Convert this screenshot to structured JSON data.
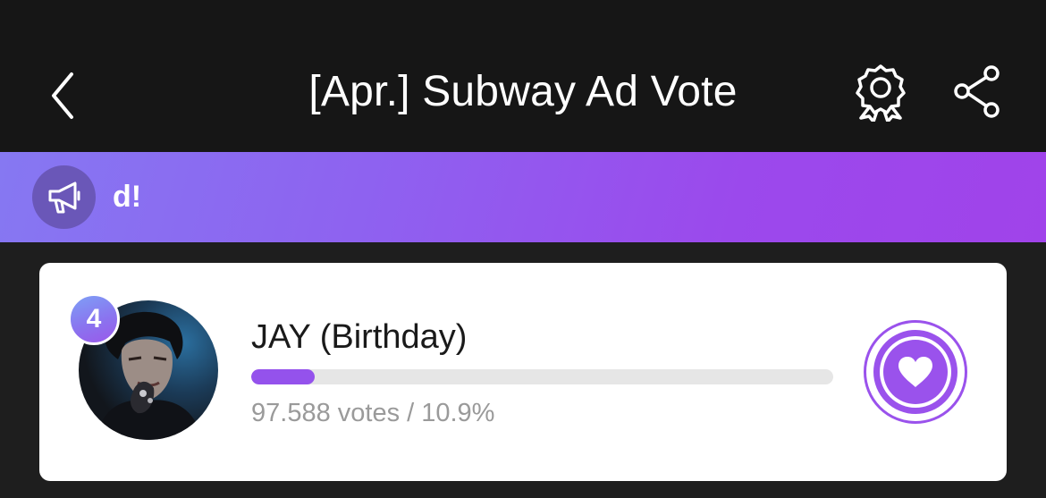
{
  "header": {
    "title": "[Apr.] Subway Ad Vote",
    "back_icon": "chevron-left-icon",
    "award_icon": "award-ribbon-icon",
    "share_icon": "share-icon"
  },
  "banner": {
    "icon": "megaphone-icon",
    "text": "d!"
  },
  "candidate": {
    "rank": "4",
    "name": "JAY (Birthday)",
    "votes_text": "97.588 votes / 10.9%",
    "percent": 10.9,
    "vote_icon": "heart-icon"
  },
  "colors": {
    "accent": "#9a52ec",
    "header_bg": "#161616",
    "page_bg": "#1e1e1e"
  }
}
